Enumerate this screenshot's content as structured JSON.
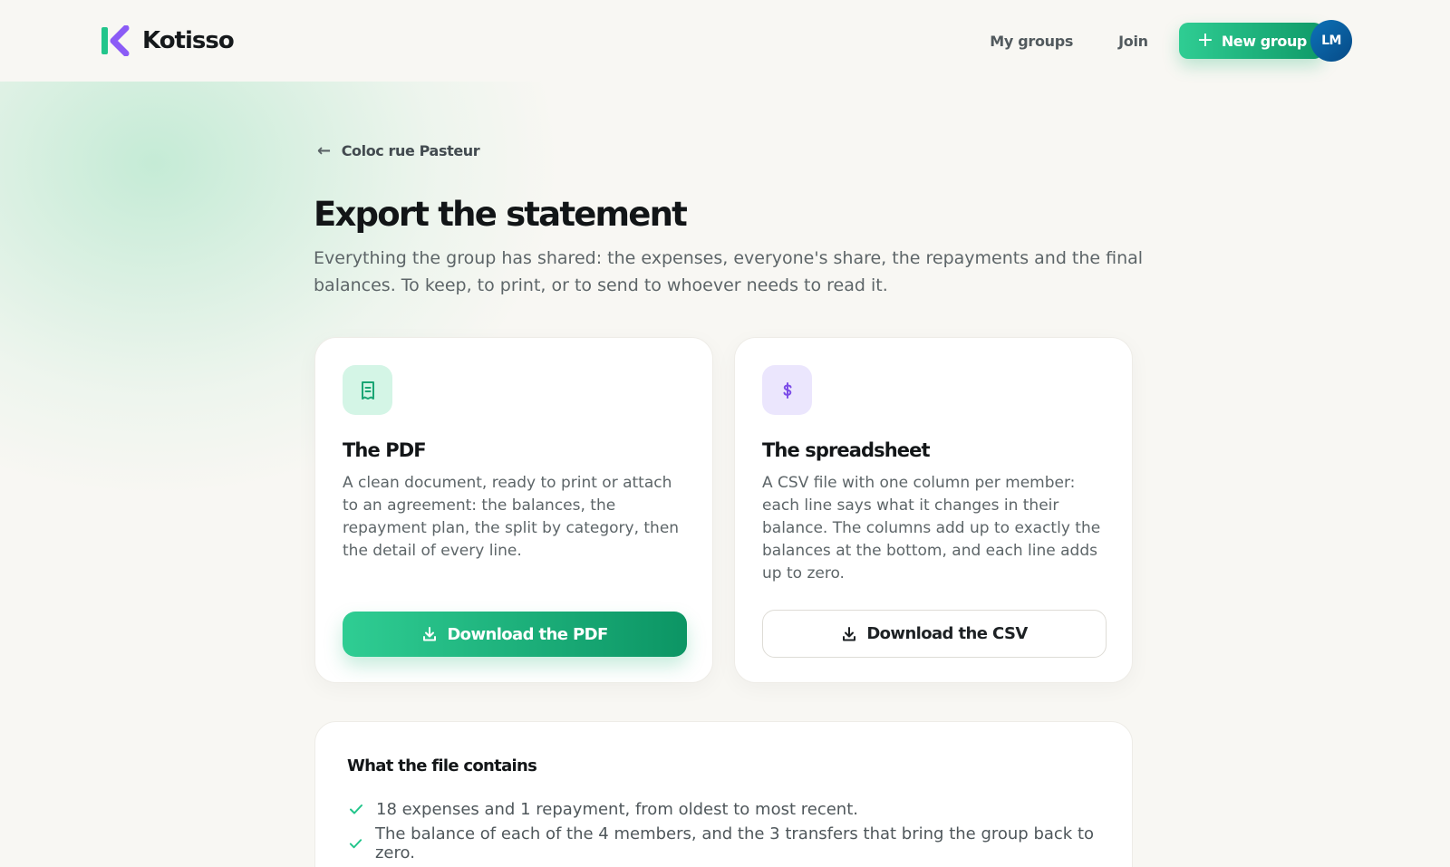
{
  "brand": {
    "name": "Kotisso",
    "accent": "#22c58b",
    "logo_violet": "#8b5cf6"
  },
  "nav": {
    "my_groups": "My groups",
    "join": "Join",
    "new_group": "New group",
    "avatar_initials": "LM"
  },
  "breadcrumb": {
    "back_label": "Coloc rue Pasteur"
  },
  "page": {
    "title": "Export the statement",
    "description": "Everything the group has shared: the expenses, everyone's share, the repayments and the final balances. To keep, to print, or to send to whoever needs to read it."
  },
  "cards": {
    "pdf": {
      "icon": "receipt-icon",
      "title": "The PDF",
      "text": "A clean document, ready to print or attach to an agreement: the balances, the repayment plan, the split by category, then the detail of every line.",
      "button": "Download the PDF"
    },
    "csv": {
      "icon": "dollar-icon",
      "title": "The spreadsheet",
      "text": "A CSV file with one column per member: each line says what it changes in their balance. The columns add up to exactly the balances at the bottom, and each line adds up to zero.",
      "button": "Download the CSV"
    }
  },
  "contents": {
    "title": "What the file contains",
    "items": [
      "18 expenses and 1 repayment, from oldest to most recent.",
      "The balance of each of the 4 members, and the 3 transfers that bring the group back to zero."
    ]
  }
}
